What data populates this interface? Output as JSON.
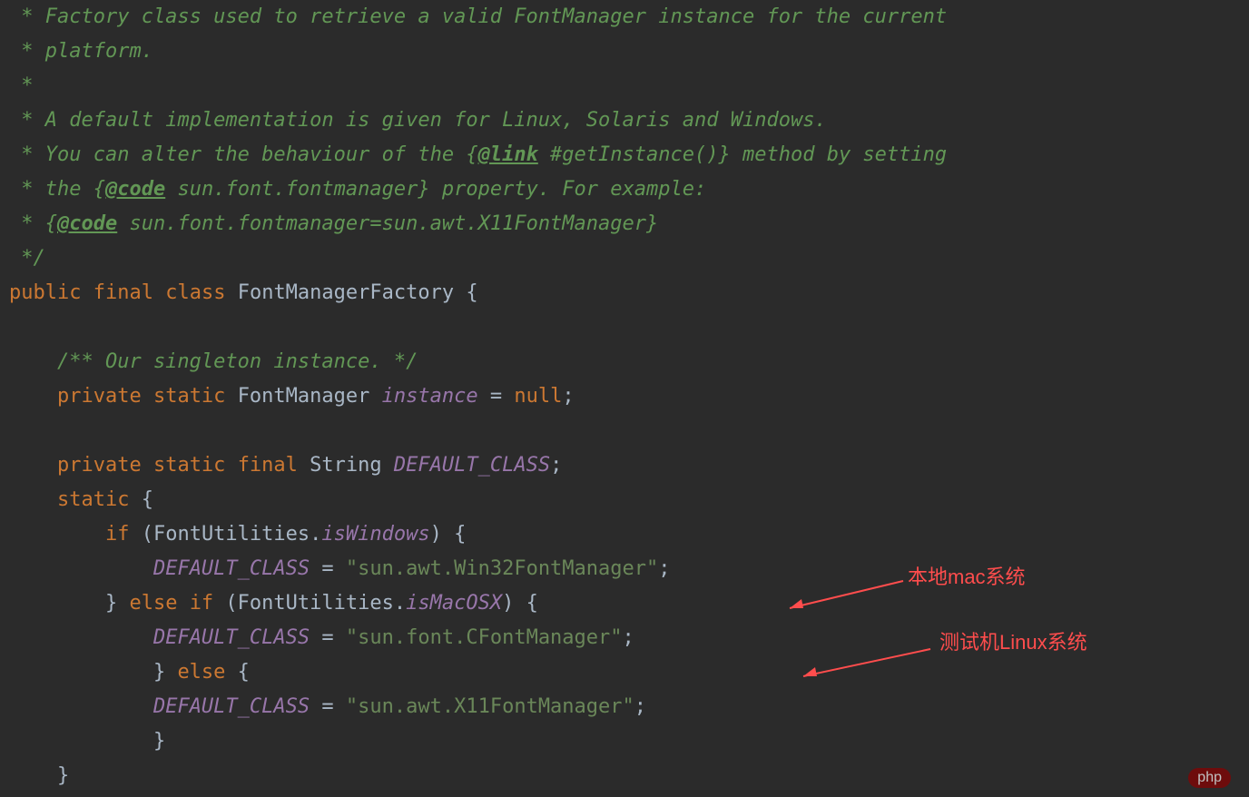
{
  "code": {
    "line1": " *",
    "line2_prefix": " * ",
    "line2_text": "platform.",
    "line3": " *",
    "line4_prefix": " * ",
    "line4_text": "A default implementation is given for Linux, Solaris and Windows.",
    "line5_prefix": " * ",
    "line5_text1": "You can alter the behaviour of the {",
    "line5_tag": "@link",
    "line5_text2": " #getInstance()} method by setting",
    "line6_prefix": " * ",
    "line6_text1": "the {",
    "line6_tag": "@code",
    "line6_text2": " sun.font.fontmanager} property. For example:",
    "line7_prefix": " * ",
    "line7_text1": "{",
    "line7_tag": "@code",
    "line7_text2": " sun.font.fontmanager=sun.awt.X11FontManager}",
    "line8": " */",
    "line9_kw1": "public",
    "line9_kw2": "final",
    "line9_kw3": "class",
    "line9_class": "FontManagerFactory",
    "line9_brace": " {",
    "line11_comment": "    /** Our singleton instance. */",
    "line12_indent": "    ",
    "line12_kw1": "private",
    "line12_kw2": "static",
    "line12_type": "FontManager",
    "line12_field": "instance",
    "line12_eq": " = ",
    "line12_kw3": "null",
    "line12_semi": ";",
    "line14_indent": "    ",
    "line14_kw1": "private",
    "line14_kw2": "static",
    "line14_kw3": "final",
    "line14_type": "String",
    "line14_field": "DEFAULT_CLASS",
    "line14_semi": ";",
    "line15_indent": "    ",
    "line15_kw": "static",
    "line15_brace": " {",
    "line16_indent": "        ",
    "line16_kw": "if",
    "line16_open": " (FontUtilities.",
    "line16_field": "isWindows",
    "line16_close": ") {",
    "line17_indent": "            ",
    "line17_field": "DEFAULT_CLASS",
    "line17_eq": " = ",
    "line17_str": "\"sun.awt.Win32FontManager\"",
    "line17_semi": ";",
    "line18_indent": "        } ",
    "line18_kw1": "else",
    "line18_kw2": "if",
    "line18_open": " (FontUtilities.",
    "line18_field": "isMacOSX",
    "line18_close": ") {",
    "line19_indent": "            ",
    "line19_field": "DEFAULT_CLASS",
    "line19_eq": " = ",
    "line19_str": "\"sun.font.CFontManager\"",
    "line19_semi": ";",
    "line20_indent": "            } ",
    "line20_kw": "else",
    "line20_brace": " {",
    "line21_indent": "            ",
    "line21_field": "DEFAULT_CLASS",
    "line21_eq": " = ",
    "line21_str": "\"sun.awt.X11FontManager\"",
    "line21_semi": ";",
    "line22": "            }",
    "line23": "    }"
  },
  "annotations": {
    "mac_label": "本地mac系统",
    "linux_label": "测试机Linux系统"
  },
  "watermark": "php"
}
